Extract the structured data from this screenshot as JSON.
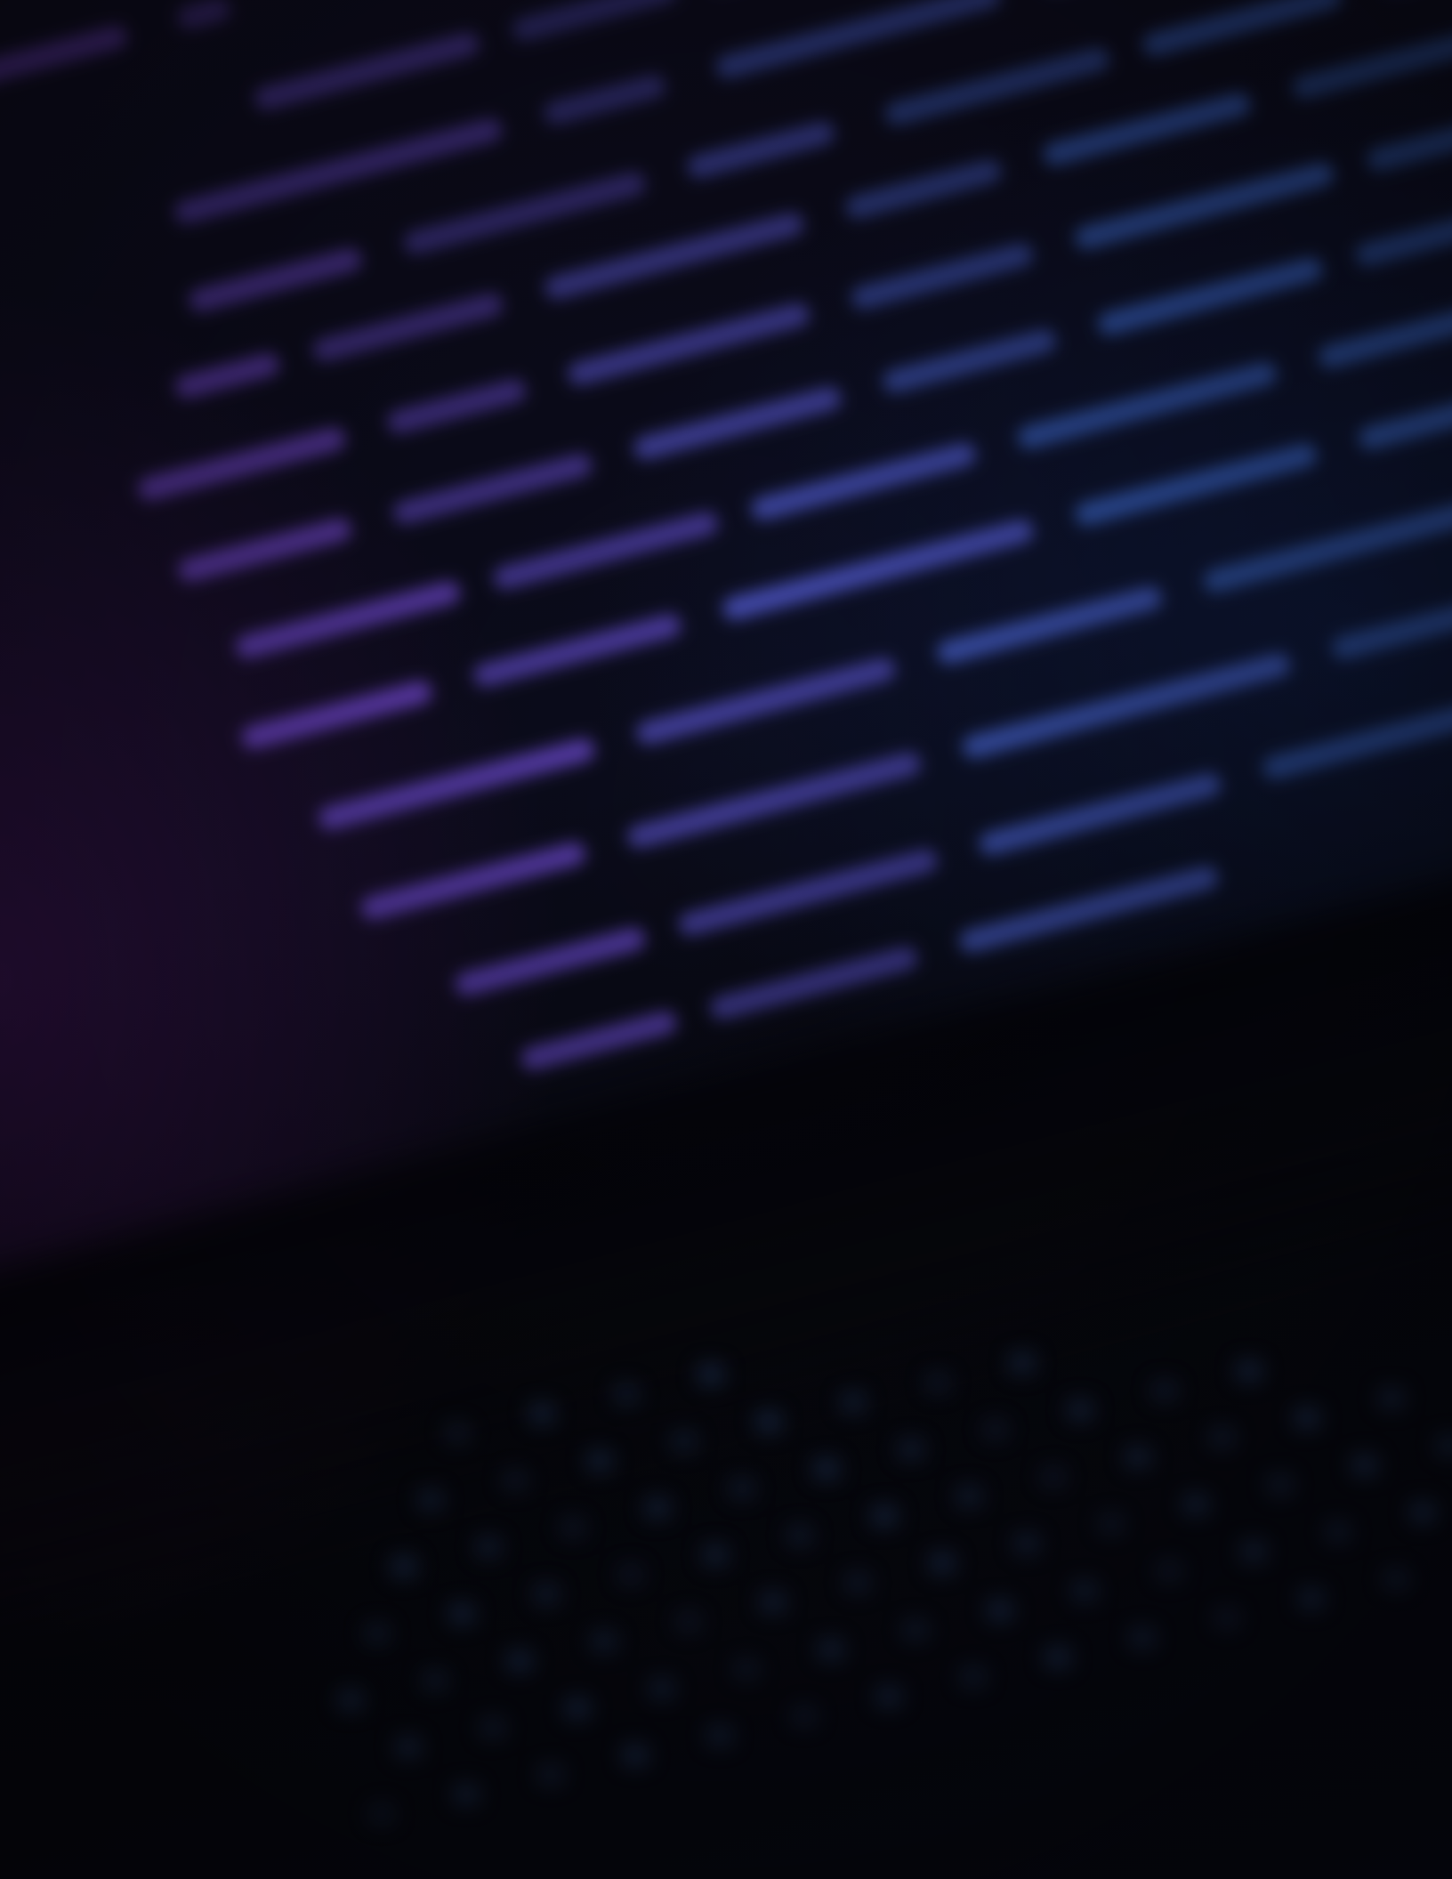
{
  "photo": {
    "subject": "blurred-laptop-code-screen",
    "palette": {
      "background": "#07070f",
      "purple": "#7a3ec8",
      "violet": "#5a48c0",
      "blue": "#3a64c8",
      "steel": "#2c4f9a",
      "keyboard": "#27406f"
    }
  }
}
